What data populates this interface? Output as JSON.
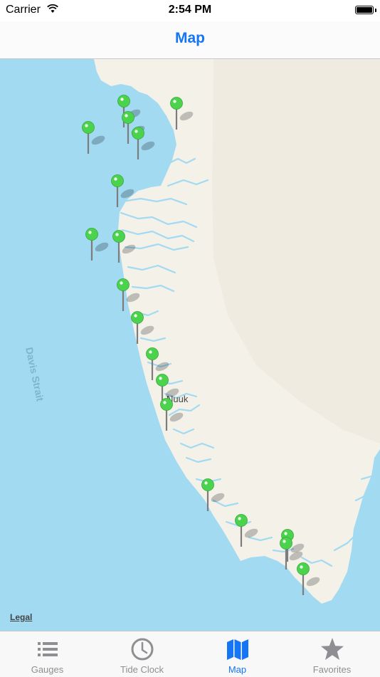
{
  "status_bar": {
    "carrier": "Carrier",
    "time": "2:54 PM"
  },
  "nav": {
    "title": "Map"
  },
  "map": {
    "sea_label": "Davis Strait",
    "city_label": "Nuuk",
    "legal_label": "Legal",
    "colors": {
      "sea": "#a2daf2",
      "land": "#f4f1e9",
      "pin": "#4cd34d"
    },
    "pin_count": 20
  },
  "tabs": [
    {
      "label": "Gauges",
      "icon": "list-icon",
      "active": false
    },
    {
      "label": "Tide Clock",
      "icon": "clock-icon",
      "active": false
    },
    {
      "label": "Map",
      "icon": "map-icon",
      "active": true
    },
    {
      "label": "Favorites",
      "icon": "star-icon",
      "active": false
    }
  ]
}
